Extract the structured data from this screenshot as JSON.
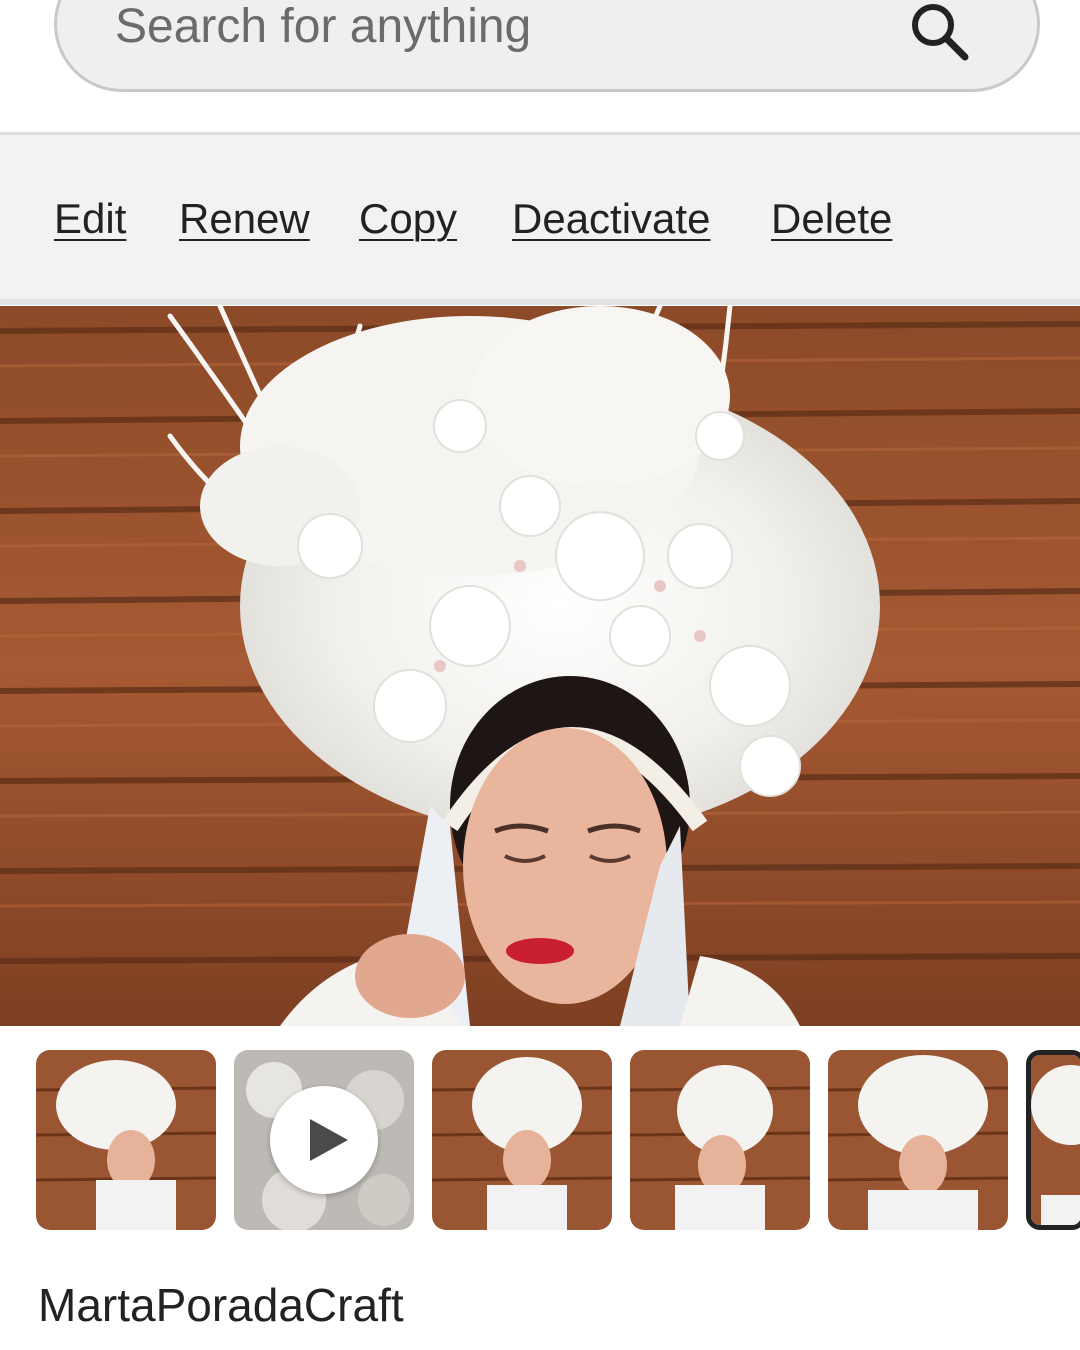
{
  "search": {
    "placeholder": "Search for anything",
    "icon": "search-icon"
  },
  "actions": [
    {
      "label": "Edit"
    },
    {
      "label": "Renew"
    },
    {
      "label": "Copy"
    },
    {
      "label": "Deactivate"
    },
    {
      "label": "Delete"
    }
  ],
  "hero_image": {
    "subject": "woman wearing white floral crown headdress",
    "colors": {
      "wall": "#8a4a2a",
      "crown": "#f4f3f0"
    }
  },
  "thumbnails": [
    {
      "type": "image"
    },
    {
      "type": "video",
      "icon": "play-icon"
    },
    {
      "type": "image"
    },
    {
      "type": "image"
    },
    {
      "type": "image"
    },
    {
      "type": "image",
      "selected": true
    }
  ],
  "shop": {
    "name": "MartaPoradaCraft"
  }
}
